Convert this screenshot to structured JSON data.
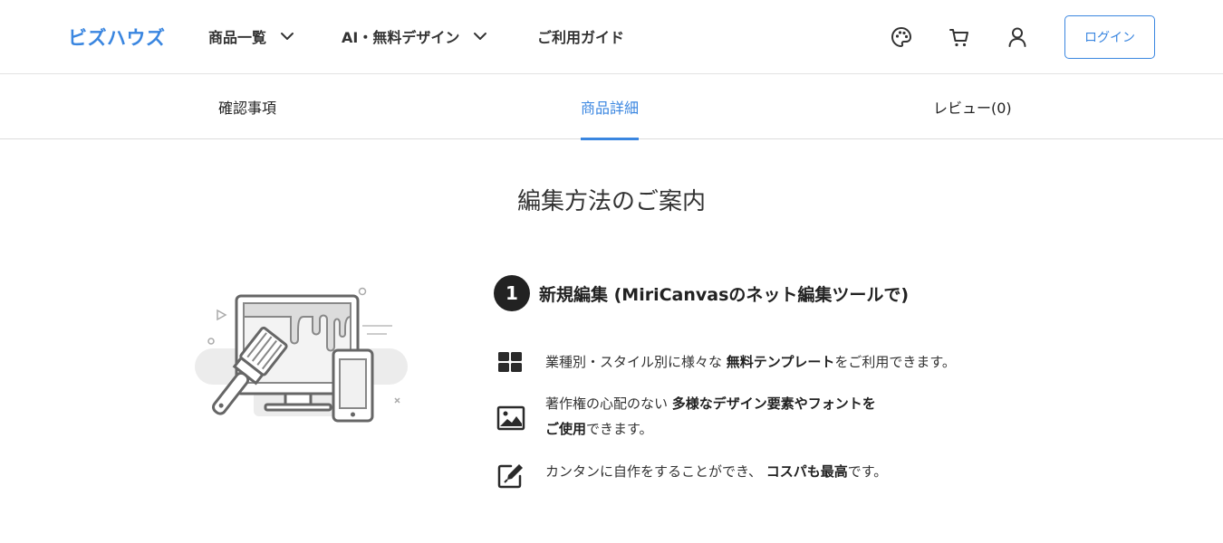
{
  "header": {
    "logo": "ビズハウズ",
    "nav": [
      {
        "label": "商品一覧"
      },
      {
        "label": "AI・無料デザイン"
      },
      {
        "label": "ご利用ガイド"
      }
    ],
    "icons": [
      "palette-icon",
      "cart-icon",
      "user-icon",
      "chevron-down-icon"
    ],
    "login_label": "ログイン",
    "accent_color": "#3a86e0"
  },
  "tabs": [
    {
      "label": "確認事項",
      "active": false
    },
    {
      "label": "商品詳細",
      "active": true
    },
    {
      "label": "レビュー(0)",
      "active": false
    }
  ],
  "content": {
    "section_title": "編集方法のご案内",
    "step": {
      "number": "1",
      "title": "新規編集 (MiriCanvasのネット編集ツールで)"
    },
    "features": [
      {
        "icon": "grid-icon",
        "pre": "業種別・スタイル別に様々な ",
        "bold": "無料テンプレート",
        "post": "をご利用できます。"
      },
      {
        "icon": "image-icon",
        "line1_pre": "著作権の心配のない ",
        "line1_bold": "多様なデザイン要素やフォントを",
        "line2_bold": "ご使用",
        "line2_post": "できます。"
      },
      {
        "icon": "edit-icon",
        "pre": "カンタンに自作をすることができ、 ",
        "bold": "コスパも最高",
        "post": "です。"
      }
    ]
  }
}
